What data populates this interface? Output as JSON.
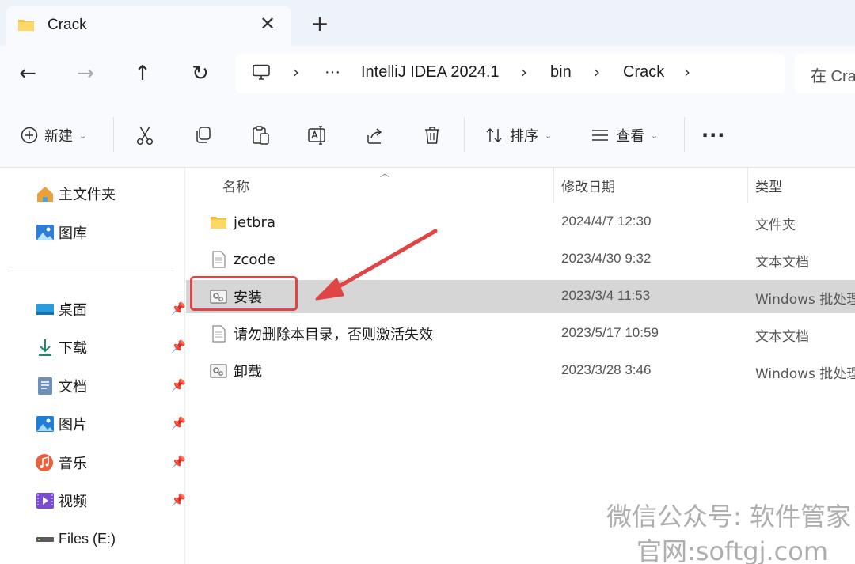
{
  "tab": {
    "title": "Crack",
    "close": "✕",
    "new_tab": "+"
  },
  "nav": {
    "back": "←",
    "forward": "→",
    "up": "↑",
    "refresh": "↻"
  },
  "breadcrumb": {
    "more": "···",
    "sep": "›",
    "items": [
      "IntelliJ IDEA 2024.1",
      "bin",
      "Crack"
    ]
  },
  "search": {
    "placeholder": "在 Crack 中搜索"
  },
  "toolbar": {
    "new_label": "新建",
    "sort_label": "排序",
    "view_label": "查看",
    "more_label": "···",
    "icons": [
      "cut-icon",
      "copy-icon",
      "paste-icon",
      "rename-icon",
      "share-icon",
      "delete-icon"
    ]
  },
  "sidebar": {
    "top": [
      {
        "label": "主文件夹",
        "icon": "home-icon"
      },
      {
        "label": "图库",
        "icon": "gallery-icon"
      }
    ],
    "quick": [
      {
        "label": "桌面",
        "icon": "desktop-icon",
        "pinned": true
      },
      {
        "label": "下载",
        "icon": "download-icon",
        "pinned": true
      },
      {
        "label": "文档",
        "icon": "documents-icon",
        "pinned": true
      },
      {
        "label": "图片",
        "icon": "pictures-icon",
        "pinned": true
      },
      {
        "label": "音乐",
        "icon": "music-icon",
        "pinned": true
      },
      {
        "label": "视频",
        "icon": "videos-icon",
        "pinned": true
      },
      {
        "label": "Files (E:)",
        "icon": "drive-icon",
        "pinned": false
      }
    ]
  },
  "columns": {
    "name": "名称",
    "date": "修改日期",
    "type": "类型"
  },
  "files": [
    {
      "name": "jetbra",
      "date": "2024/4/7 12:30",
      "type": "文件夹",
      "icon": "folder-icon",
      "selected": false
    },
    {
      "name": "zcode",
      "date": "2023/4/30 9:32",
      "type": "文本文档",
      "icon": "text-file-icon",
      "selected": false
    },
    {
      "name": "安装",
      "date": "2023/3/4 11:53",
      "type": "Windows 批处理",
      "icon": "batch-file-icon",
      "selected": true
    },
    {
      "name": "请勿删除本目录，否则激活失效",
      "date": "2023/5/17 10:59",
      "type": "文本文档",
      "icon": "text-file-icon",
      "selected": false
    },
    {
      "name": "卸载",
      "date": "2023/3/28 3:46",
      "type": "Windows 批处理",
      "icon": "batch-file-icon",
      "selected": false
    }
  ],
  "watermark": {
    "line1": "微信公众号: 软件管家",
    "line2": "官网:softgj.com"
  },
  "colors": {
    "accent": "#0067c0",
    "annotation": "#e04545",
    "selected_row": "#d6d6d6"
  }
}
